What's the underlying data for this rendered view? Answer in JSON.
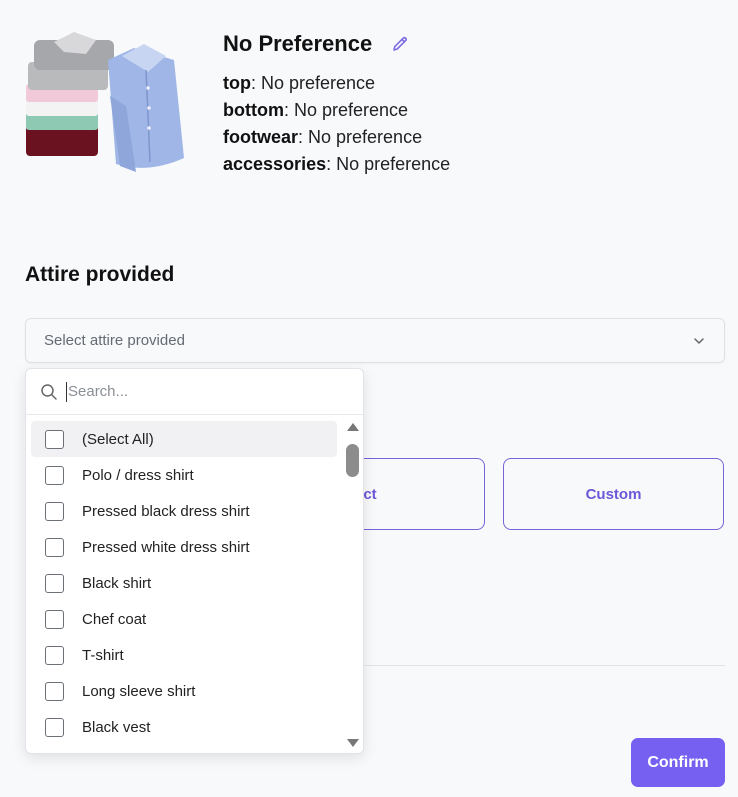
{
  "preference": {
    "title": "No Preference",
    "lines": [
      {
        "label": "top",
        "value": ": No preference"
      },
      {
        "label": "bottom",
        "value": ": No preference"
      },
      {
        "label": "footwear",
        "value": ": No preference"
      },
      {
        "label": "accessories",
        "value": ": No preference"
      }
    ]
  },
  "attire": {
    "section_title": "Attire provided",
    "select_placeholder": "Select attire provided",
    "search_placeholder": "Search...",
    "options": [
      "(Select All)",
      "Polo / dress shirt",
      "Pressed black dress shirt",
      "Pressed white dress shirt",
      "Black shirt",
      "Chef coat",
      "T-shirt",
      "Long sleeve shirt",
      "Black vest"
    ]
  },
  "option_cards": {
    "strict_partial": "trict",
    "custom": "Custom"
  },
  "footer": {
    "confirm_label": "Confirm"
  },
  "colors": {
    "accent": "#7560f2",
    "card_border": "#7a63d8"
  }
}
